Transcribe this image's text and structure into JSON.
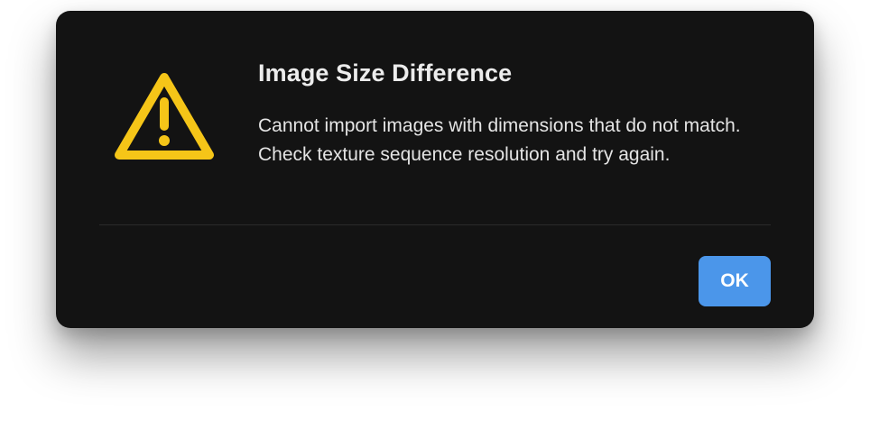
{
  "dialog": {
    "icon": "warning-icon",
    "title": "Image Size Difference",
    "message": "Cannot import images with dimensions that do not match. Check texture sequence resolution and try again.",
    "ok_label": "OK"
  },
  "colors": {
    "background": "#131313",
    "warning": "#f5c518",
    "accent": "#4b96ea",
    "text": "#ececec"
  }
}
